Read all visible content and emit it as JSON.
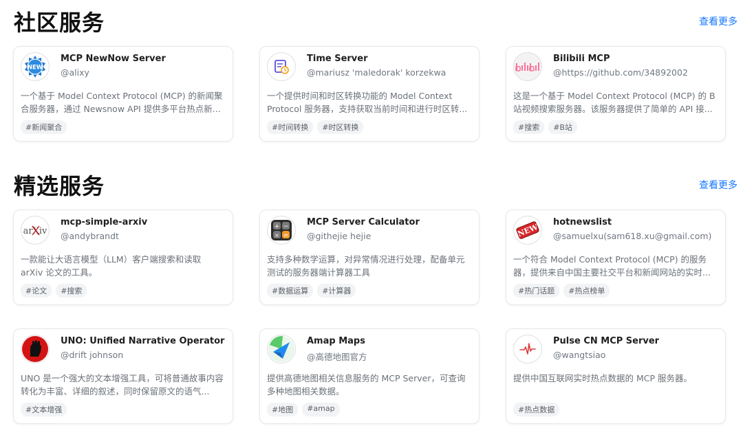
{
  "sections": [
    {
      "title": "社区服务",
      "more": "查看更多",
      "cards": [
        {
          "title": "MCP NewNow Server",
          "author": "@alixy",
          "icon": "new-badge-icon",
          "desc": "一个基于 Model Context Protocol (MCP) 的新闻聚合服务器，通过 Newsnow API 提供多平台热点新...",
          "tags": [
            "#新闻聚合"
          ]
        },
        {
          "title": "Time Server",
          "author": "@mariusz 'maledorak' korzekwa",
          "icon": "time-schedule-icon",
          "desc": "一个提供时间和时区转换功能的 Model Context Protocol 服务器，支持获取当前时间和进行时区转...",
          "tags": [
            "#时间转换",
            "#时区转换"
          ]
        },
        {
          "title": "Bilibili MCP",
          "author": "@https://github.com/34892002",
          "icon": "bilibili-logo-icon",
          "desc": "这是一个基于 Model Context Protocol (MCP) 的 B 站视频搜索服务器。该服务器提供了简单的 API 接...",
          "tags": [
            "#搜索",
            "#B站"
          ]
        }
      ]
    },
    {
      "title": "精选服务",
      "more": "查看更多",
      "cards": [
        {
          "title": "mcp-simple-arxiv",
          "author": "@andybrandt",
          "icon": "arxiv-logo-icon",
          "desc": "一款能让大语言模型（LLM）客户端搜索和读取 arXiv 论文的工具。",
          "tags": [
            "#论文",
            "#搜索"
          ]
        },
        {
          "title": "MCP Server Calculator",
          "author": "@githejie hejie",
          "icon": "calculator-icon",
          "desc": "支持多种数学运算，对异常情况进行处理，配备单元测试的服务器端计算器工具",
          "tags": [
            "#数据运算",
            "#计算器"
          ]
        },
        {
          "title": "hotnewslist",
          "author": "@samuelxu(sam618.xu@gmail.com)",
          "icon": "new-stamp-icon",
          "desc": "一个符合 Model Context Protocol (MCP) 的服务器，提供来自中国主要社交平台和新闻网站的实时...",
          "tags": [
            "#热门话题",
            "#热点榜单"
          ]
        },
        {
          "title": "UNO: Unified Narrative Operator",
          "author": "@drift johnson",
          "icon": "raised-fist-icon",
          "desc": "UNO 是一个强大的文本增强工具，可将普通故事内容转化为丰富、详细的叙述，同时保留原文的语气...",
          "tags": [
            "#文本增强"
          ]
        },
        {
          "title": "Amap Maps",
          "author": "@高德地图官方",
          "icon": "amap-logo-icon",
          "desc": "提供高德地图相关信息服务的 MCP Server，可查询多种地图相关数据。",
          "tags": [
            "#地图",
            "#amap"
          ]
        },
        {
          "title": "Pulse CN MCP Server",
          "author": "@wangtsiao",
          "icon": "pulse-icon",
          "desc": "提供中国互联网实时热点数据的 MCP 服务器。",
          "tags": [
            "#热点数据"
          ]
        }
      ]
    }
  ]
}
